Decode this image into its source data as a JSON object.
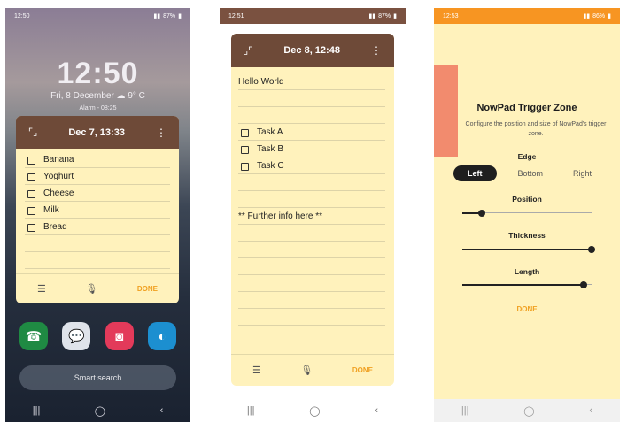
{
  "phone1": {
    "status_time": "12:50",
    "status_right": "87%",
    "clock": "12:50",
    "date_weather": "Fri, 8 December  ☁ 9° C",
    "alarm": "Alarm - 08:25",
    "note_title": "Dec 7, 13:33",
    "items": [
      {
        "text": "Banana"
      },
      {
        "text": "Yoghurt"
      },
      {
        "text": "Cheese"
      },
      {
        "text": "Milk"
      },
      {
        "text": "Bread"
      }
    ],
    "done_label": "DONE",
    "search_label": "Smart search",
    "apps": [
      "phone-app",
      "messages-app",
      "camera-app",
      "edge-app"
    ]
  },
  "phone2": {
    "status_time": "12:51",
    "status_right": "87%",
    "note_title": "Dec 8, 12:48",
    "line_hello": "Hello World",
    "tasks": [
      {
        "text": "Task A"
      },
      {
        "text": "Task B"
      },
      {
        "text": "Task C"
      }
    ],
    "further": "** Further info here **",
    "done_label": "DONE"
  },
  "phone3": {
    "status_time": "12:53",
    "status_right": "86%",
    "title": "NowPad Trigger Zone",
    "subtitle": "Configure the position and size of NowPad's trigger zone.",
    "edge_label": "Edge",
    "edge_options": [
      "Left",
      "Bottom",
      "Right"
    ],
    "edge_selected": "Left",
    "position_label": "Position",
    "position_value": 0.15,
    "thickness_label": "Thickness",
    "thickness_value": 1.0,
    "length_label": "Length",
    "length_value": 0.94,
    "done_label": "DONE"
  },
  "colors": {
    "note_bg": "#fff2bc",
    "note_header": "#6e4a38",
    "accent": "#f0a020",
    "status_orange": "#f79522",
    "trigger_zone": "#f28b6e"
  }
}
